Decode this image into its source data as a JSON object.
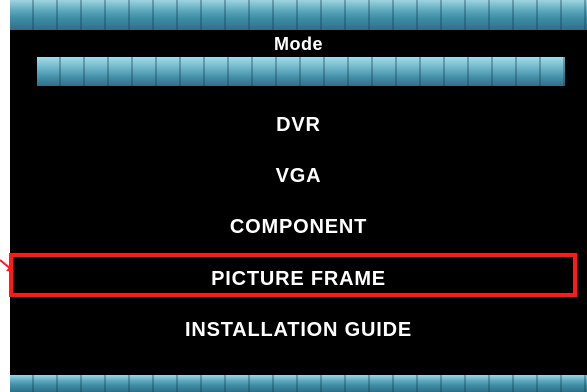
{
  "window": {
    "title": "Mode"
  },
  "menu": {
    "items": [
      {
        "label": "DVR"
      },
      {
        "label": "VGA"
      },
      {
        "label": "COMPONENT"
      },
      {
        "label": "PICTURE FRAME"
      },
      {
        "label": "INSTALLATION GUIDE"
      }
    ],
    "selected_label": "PICTURE FRAME"
  },
  "colors": {
    "background": "#000000",
    "text": "#ffffff",
    "bar_accent": "#5ea8bc",
    "highlight": "#ff1a1a"
  },
  "icons": {
    "pointer": "arrow-pointer-icon"
  }
}
